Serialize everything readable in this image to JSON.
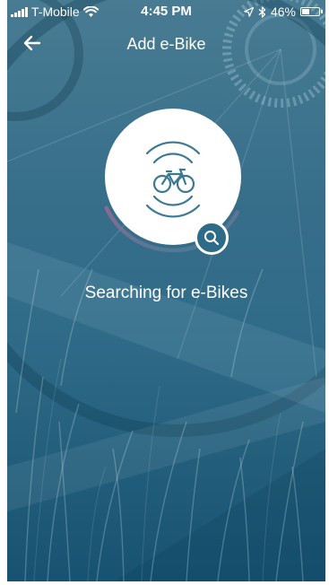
{
  "status_bar": {
    "carrier": "T-Mobile",
    "time": "4:45 PM",
    "battery": "46%",
    "battery_level": 0.46,
    "icons": [
      "signal-icon",
      "wifi-icon",
      "location-icon",
      "bluetooth-icon",
      "battery-icon"
    ]
  },
  "nav": {
    "title": "Add e-Bike",
    "back_icon": "back-arrow-icon"
  },
  "scanner": {
    "icon": "bicycle-icon",
    "badge_icon": "search-icon",
    "progress": 0.35
  },
  "status_message": "Searching for e-Bikes",
  "colors": {
    "accent": "#2e6b89",
    "arc_start": "#8a6a92",
    "arc_end": "#3f7e97"
  }
}
